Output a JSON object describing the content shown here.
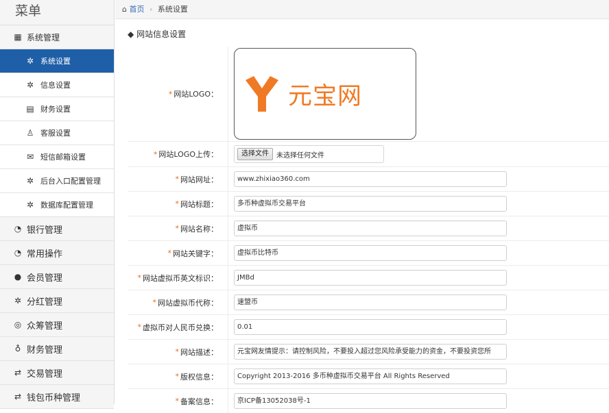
{
  "sidebar": {
    "title": "菜单",
    "section": "系统管理",
    "subitems": [
      {
        "label": "系统设置",
        "icon": "gear-icon"
      },
      {
        "label": "信息设置",
        "icon": "gear-icon"
      },
      {
        "label": "财务设置",
        "icon": "ledger-icon"
      },
      {
        "label": "客服设置",
        "icon": "user-headset-icon"
      },
      {
        "label": "短信邮箱设置",
        "icon": "envelope-icon"
      },
      {
        "label": "后台入口配置管理",
        "icon": "gear-icon"
      },
      {
        "label": "数据库配置管理",
        "icon": "gear-icon"
      }
    ],
    "groups": [
      {
        "label": "银行管理",
        "icon": "circle-arrow-icon"
      },
      {
        "label": "常用操作",
        "icon": "circle-arrow-icon"
      },
      {
        "label": "会员管理",
        "icon": "user-icon"
      },
      {
        "label": "分红管理",
        "icon": "gear-icon"
      },
      {
        "label": "众筹管理",
        "icon": "search-circle-icon"
      },
      {
        "label": "财务管理",
        "icon": "money-bag-icon"
      },
      {
        "label": "交易管理",
        "icon": "exchange-icon"
      },
      {
        "label": "钱包币种管理",
        "icon": "exchange-icon"
      }
    ]
  },
  "breadcrumb": {
    "home": "首页",
    "current": "系统设置"
  },
  "section_title": "网站信息设置",
  "logo": {
    "label": "网站LOGO：",
    "brand_text": "元宝网",
    "brand_color": "#f07a24"
  },
  "upload": {
    "label": "网站LOGO上传：",
    "button": "选择文件",
    "note": "未选择任何文件"
  },
  "fields": [
    {
      "label": "网站网址：",
      "value": "www.zhixiao360.com"
    },
    {
      "label": "网站标题：",
      "value": "多币种虚拟币交易平台"
    },
    {
      "label": "网站名称：",
      "value": "虚拟币"
    },
    {
      "label": "网站关键字：",
      "value": "虚拟币比特币"
    },
    {
      "label": "网站虚拟币英文标识：",
      "value": "JMBd"
    },
    {
      "label": "网站虚拟币代称：",
      "value": "速盟币"
    },
    {
      "label": "虚拟币对人民币兑换：",
      "value": "0.01"
    },
    {
      "label": "网站描述：",
      "value": "元宝网友情提示：请控制风险，不要投入超过您风险承受能力的资金，不要投资您所"
    },
    {
      "label": "版权信息：",
      "value": "Copyright 2013-2016 多币种虚拟币交易平台 All Rights Reserved"
    },
    {
      "label": "备案信息：",
      "value": "京ICP备13052038号-1"
    }
  ],
  "colors": {
    "accent": "#1f5fa8",
    "required": "#e86c1a"
  }
}
